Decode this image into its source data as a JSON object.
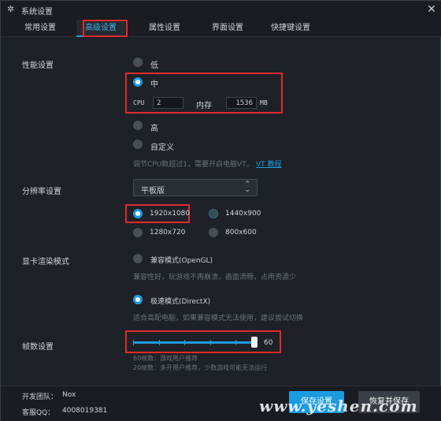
{
  "window": {
    "title": "系统设置"
  },
  "tabs": [
    {
      "label": "常用设置"
    },
    {
      "label": "高级设置"
    },
    {
      "label": "属性设置"
    },
    {
      "label": "界面设置"
    },
    {
      "label": "快捷键设置"
    }
  ],
  "performance": {
    "section_label": "性能设置",
    "options": {
      "low": "低",
      "mid": "中",
      "high": "高",
      "custom": "自定义"
    },
    "selected": "中",
    "cpu_label": "CPU",
    "cpu_value": "2",
    "memory_label": "内存",
    "memory_value": "1536",
    "memory_unit": "MB",
    "hint": "调节CPU数超过1，需要开启电脑VT。",
    "vt_link": "VT 教程"
  },
  "resolution": {
    "section_label": "分辨率设置",
    "dropdown_value": "平板版",
    "options": [
      "1920x1080",
      "1440x900",
      "1280x720",
      "800x600"
    ],
    "selected": "1920x1080"
  },
  "render": {
    "section_label": "显卡渲染模式",
    "compat_label": "兼容模式(OpenGL)",
    "compat_desc": "兼容性好，玩游戏不再崩溃，画面流畅，占用资源少",
    "speed_label": "极速模式(DirectX)",
    "speed_desc": "适合高配电脑，如果兼容模式无法使用，建议尝试切换",
    "selected": "极速模式(DirectX)"
  },
  "fps": {
    "section_label": "帧数设置",
    "value": "60",
    "slider_fraction": 1.0,
    "hint1": "60帧数：游戏用户推荐",
    "hint2": "20帧数：多开用户推荐，少数游戏可能无法运行"
  },
  "footer": {
    "team_label": "开发团队：",
    "team_value": "Nox",
    "support_label": "客服QQ：",
    "support_value": "4008019381",
    "save_label": "保存设置",
    "restore_label": "恢复并保存"
  },
  "watermark": "www.yeshen.com",
  "colors": {
    "accent": "#1c9be0",
    "highlight_box": "#e02a2a",
    "background": "#1e2127"
  }
}
